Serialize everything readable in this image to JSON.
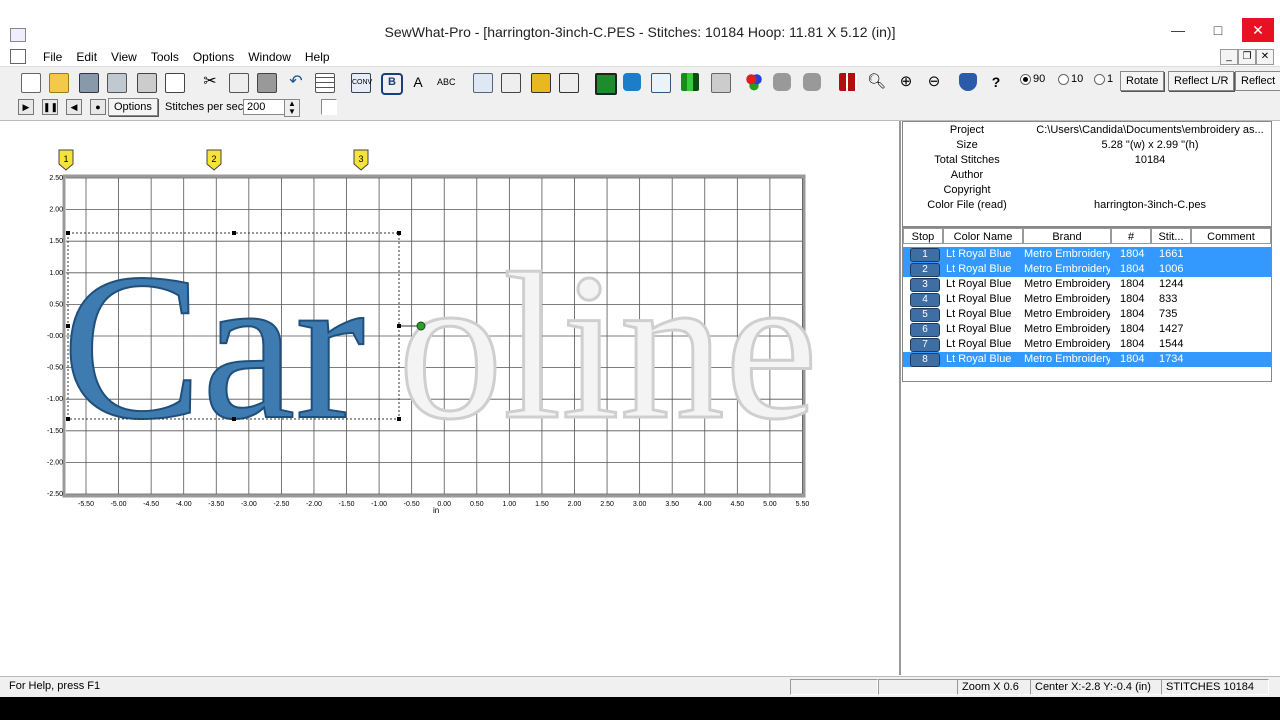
{
  "window": {
    "title": "SewWhat-Pro - [harrington-3inch-C.PES - Stitches: 10184  Hoop: 11.81 X 5.12 (in)]",
    "minimize": "—",
    "maximize": "□",
    "close": "✕"
  },
  "menu": {
    "items": [
      "File",
      "Edit",
      "View",
      "Tools",
      "Options",
      "Window",
      "Help"
    ]
  },
  "mdi": {
    "minimize": "_",
    "restore": "❐",
    "close": "✕"
  },
  "toolbar": {
    "rotation_options": [
      "90",
      "10",
      "1"
    ],
    "rotation_selected": "90",
    "rotate_label": "Rotate",
    "reflect_lr_label": "Reflect L/R",
    "reflect_label": "Reflect"
  },
  "toolbar2": {
    "options_label": "Options",
    "stitches_per_sec_label": "Stitches per sec",
    "stitches_per_sec_value": "200"
  },
  "canvas": {
    "design_text": "Caroline",
    "unit_label": "in",
    "x_ticks": [
      "-5.50",
      "-5.00",
      "-4.50",
      "-4.00",
      "-3.50",
      "-3.00",
      "-2.50",
      "-2.00",
      "-1.50",
      "-1.00",
      "-0.50",
      "0.00",
      "0.50",
      "1.00",
      "1.50",
      "2.00",
      "2.50",
      "3.00",
      "3.50",
      "4.00",
      "4.50",
      "5.00",
      "5.50"
    ],
    "y_ticks": [
      "2.50",
      "2.00",
      "1.50",
      "1.00",
      "0.50",
      "-0.00",
      "-0.50",
      "-1.00",
      "-1.50",
      "-2.00",
      "-2.50"
    ],
    "hoop_markers": [
      "1",
      "2",
      "3"
    ],
    "stitched_color": "#3e7bb0",
    "unstitched_color": "#d8d8d8"
  },
  "info": {
    "rows": [
      {
        "label": "Project",
        "value": "C:\\Users\\Candida\\Documents\\embroidery as..."
      },
      {
        "label": "Size",
        "value": "5.28 \"(w) x 2.99 \"(h)"
      },
      {
        "label": "Total Stitches",
        "value": "10184"
      },
      {
        "label": "Author",
        "value": ""
      },
      {
        "label": "Copyright",
        "value": ""
      },
      {
        "label": "Color File (read)",
        "value": "harrington-3inch-C.pes"
      }
    ]
  },
  "color_table": {
    "headers": [
      "Stop",
      "Color Name",
      "Brand",
      "#",
      "Stit...",
      "Comment"
    ],
    "rows": [
      {
        "stop": "1",
        "color_name": "Lt Royal Blue",
        "brand": "Metro Embroidery",
        "num": "1804",
        "stitches": "1661",
        "comment": "",
        "selected": true
      },
      {
        "stop": "2",
        "color_name": "Lt Royal Blue",
        "brand": "Metro Embroidery",
        "num": "1804",
        "stitches": "1006",
        "comment": "",
        "selected": true
      },
      {
        "stop": "3",
        "color_name": "Lt Royal Blue",
        "brand": "Metro Embroidery",
        "num": "1804",
        "stitches": "1244",
        "comment": "",
        "selected": false
      },
      {
        "stop": "4",
        "color_name": "Lt Royal Blue",
        "brand": "Metro Embroidery",
        "num": "1804",
        "stitches": "833",
        "comment": "",
        "selected": false
      },
      {
        "stop": "5",
        "color_name": "Lt Royal Blue",
        "brand": "Metro Embroidery",
        "num": "1804",
        "stitches": "735",
        "comment": "",
        "selected": false
      },
      {
        "stop": "6",
        "color_name": "Lt Royal Blue",
        "brand": "Metro Embroidery",
        "num": "1804",
        "stitches": "1427",
        "comment": "",
        "selected": false
      },
      {
        "stop": "7",
        "color_name": "Lt Royal Blue",
        "brand": "Metro Embroidery",
        "num": "1804",
        "stitches": "1544",
        "comment": "",
        "selected": false
      },
      {
        "stop": "8",
        "color_name": "Lt Royal Blue",
        "brand": "Metro Embroidery",
        "num": "1804",
        "stitches": "1734",
        "comment": "",
        "selected": true
      }
    ]
  },
  "status": {
    "help": "For Help, press F1",
    "zoom": "Zoom X 0.6",
    "center": "Center X:-2.8 Y:-0.4 (in)",
    "stitches": "STITCHES 10184"
  }
}
